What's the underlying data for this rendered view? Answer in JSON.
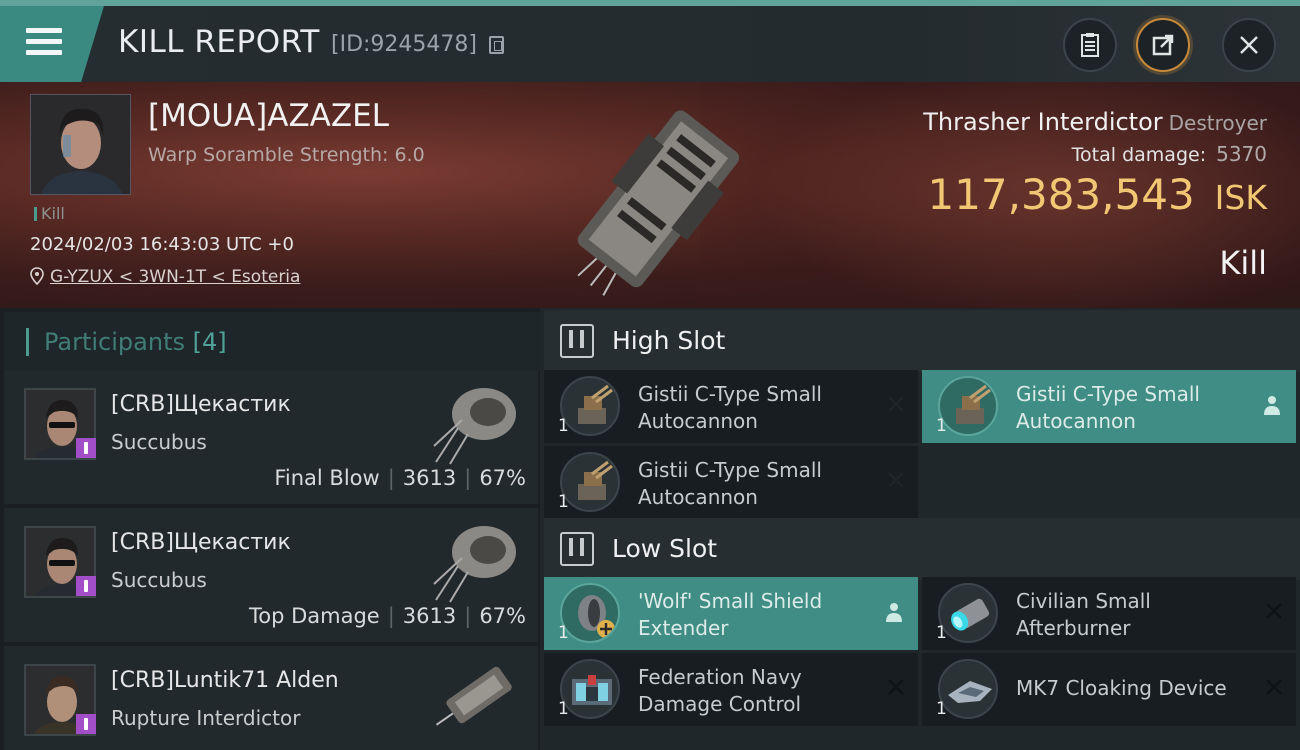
{
  "header": {
    "title": "KILL REPORT",
    "report_id": "[ID:9245478]"
  },
  "victim": {
    "name": "[MOUA]AZAZEL",
    "warp_scramble": "Warp Soramble Strength: 6.0",
    "tag": "Kill",
    "datetime": "2024/02/03 16:43:03 UTC +0",
    "location": "G-YZUX < 3WN-1T < Esoteria",
    "ship_name": "Thrasher Interdictor",
    "ship_class": "Destroyer",
    "total_damage_label": "Total damage:",
    "total_damage": "5370",
    "isk_value": "117,383,543",
    "isk_unit": "ISK",
    "result": "Kill"
  },
  "participants": {
    "title": "Participants",
    "count": "[4]",
    "items": [
      {
        "name": "[CRB]Щекастик",
        "ship": "Succubus",
        "stat_label": "Final Blow",
        "damage": "3613",
        "percent": "67%"
      },
      {
        "name": "[CRB]Щекастик",
        "ship": "Succubus",
        "stat_label": "Top Damage",
        "damage": "3613",
        "percent": "67%"
      },
      {
        "name": "[CRB]Luntik71 Alden",
        "ship": "Rupture Interdictor"
      }
    ]
  },
  "slots": {
    "high": {
      "label": "High Slot",
      "modules": [
        {
          "line1": "Gistii C-Type Small",
          "line2": "Autocannon",
          "qty": "1"
        },
        {
          "line1": "Gistii C-Type Small",
          "line2": "Autocannon",
          "qty": "1"
        },
        {
          "line1": "Gistii C-Type Small",
          "line2": "Autocannon",
          "qty": "1"
        }
      ]
    },
    "low": {
      "label": "Low Slot",
      "modules": [
        {
          "line1": "'Wolf' Small Shield",
          "line2": "Extender",
          "qty": "1"
        },
        {
          "line1": "Civilian Small",
          "line2": "Afterburner",
          "qty": "1"
        },
        {
          "line1": "Federation Navy",
          "line2": "Damage Control",
          "qty": "1"
        },
        {
          "line1": "MK7 Cloaking Device",
          "qty": "1"
        }
      ]
    }
  },
  "colors": {
    "accent_teal": "#3f8d84",
    "isk_gold": "#f2c774",
    "pilot_badge": "#a24ec8"
  }
}
